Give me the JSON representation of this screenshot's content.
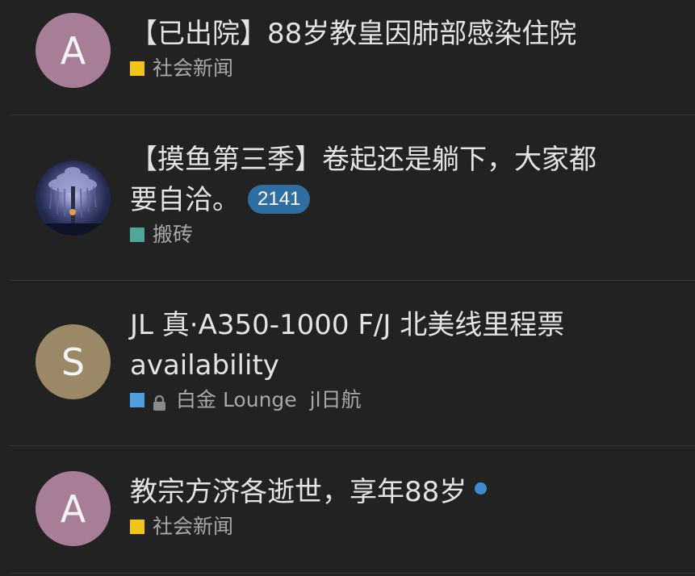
{
  "topics": [
    {
      "avatar": {
        "kind": "letter",
        "letter": "A",
        "color": "#a87d97"
      },
      "title": "【已出院】88岁教皇因肺部感染住院",
      "category": {
        "name": "社会新闻",
        "color": "#f1c41a"
      }
    },
    {
      "avatar": {
        "kind": "image",
        "icon": "tree-night-image"
      },
      "title_line1": "【摸鱼第三季】卷起还是躺下，大家都",
      "title_line2": "要自洽。",
      "badge": "2141",
      "category": {
        "name": "搬砖",
        "color": "#4ea89a"
      }
    },
    {
      "avatar": {
        "kind": "letter",
        "letter": "S",
        "color": "#9b8866"
      },
      "title_line1": "JL 真·A350-1000 F/J 北美线里程票",
      "title_line2": "availability",
      "category": {
        "name": "白金 Lounge",
        "color": "#4d9fe0",
        "icon": "lock-icon"
      },
      "tag": "jl日航"
    },
    {
      "avatar": {
        "kind": "letter",
        "letter": "A",
        "color": "#a87d97"
      },
      "title": "教宗方济各逝世，享年88岁",
      "unread": true,
      "category": {
        "name": "社会新闻",
        "color": "#f1c41a"
      }
    }
  ]
}
